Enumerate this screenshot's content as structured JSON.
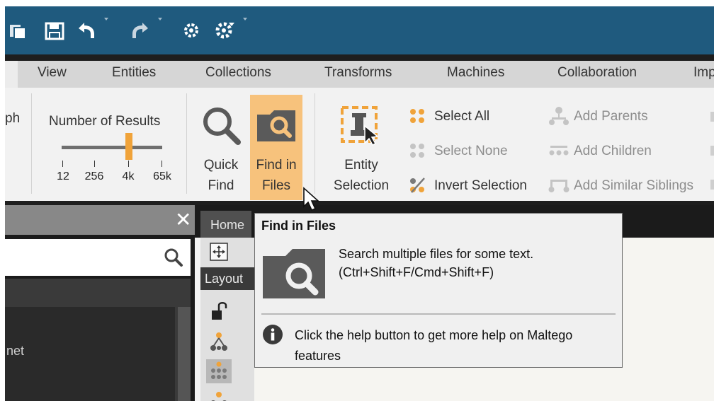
{
  "menu": {
    "items": [
      "View",
      "Entities",
      "Collections",
      "Transforms",
      "Machines",
      "Collaboration",
      "Imp"
    ]
  },
  "ribbon": {
    "graph_tail": "ph",
    "number_of_results": {
      "label": "Number of Results",
      "ticks": [
        "12",
        "256",
        "4k",
        "65k"
      ],
      "selected": "4k"
    },
    "quick_find": {
      "line1": "Quick",
      "line2": "Find"
    },
    "find_in_files": {
      "line1": "Find in",
      "line2": "Files"
    },
    "entity_selection": {
      "line1": "Entity",
      "line2": "Selection"
    },
    "select_all": "Select All",
    "select_none": "Select None",
    "invert_selection": "Invert Selection",
    "add_parents": "Add Parents",
    "add_children": "Add Children",
    "add_similar_siblings": "Add Similar Siblings"
  },
  "left_panel": {
    "close_glyph": "✕",
    "list_item": "net"
  },
  "graph": {
    "tab_label": "Home",
    "layout_label": "Layout"
  },
  "tooltip": {
    "title": "Find in Files",
    "description_line1": "Search multiple files for some text.",
    "description_line2": "(Ctrl+Shift+F/Cmd+Shift+F)",
    "help_text": "Click the help button to get more help on Maltego features"
  },
  "icons": {
    "qat": [
      "window-icon",
      "save-icon",
      "undo-icon",
      "redo-icon",
      "settings-icon",
      "settings-dropdown-icon"
    ]
  },
  "colors": {
    "title_bar": "#1f5a7e",
    "accent_orange": "#f0a33a",
    "highlight": "#f7c27c"
  }
}
